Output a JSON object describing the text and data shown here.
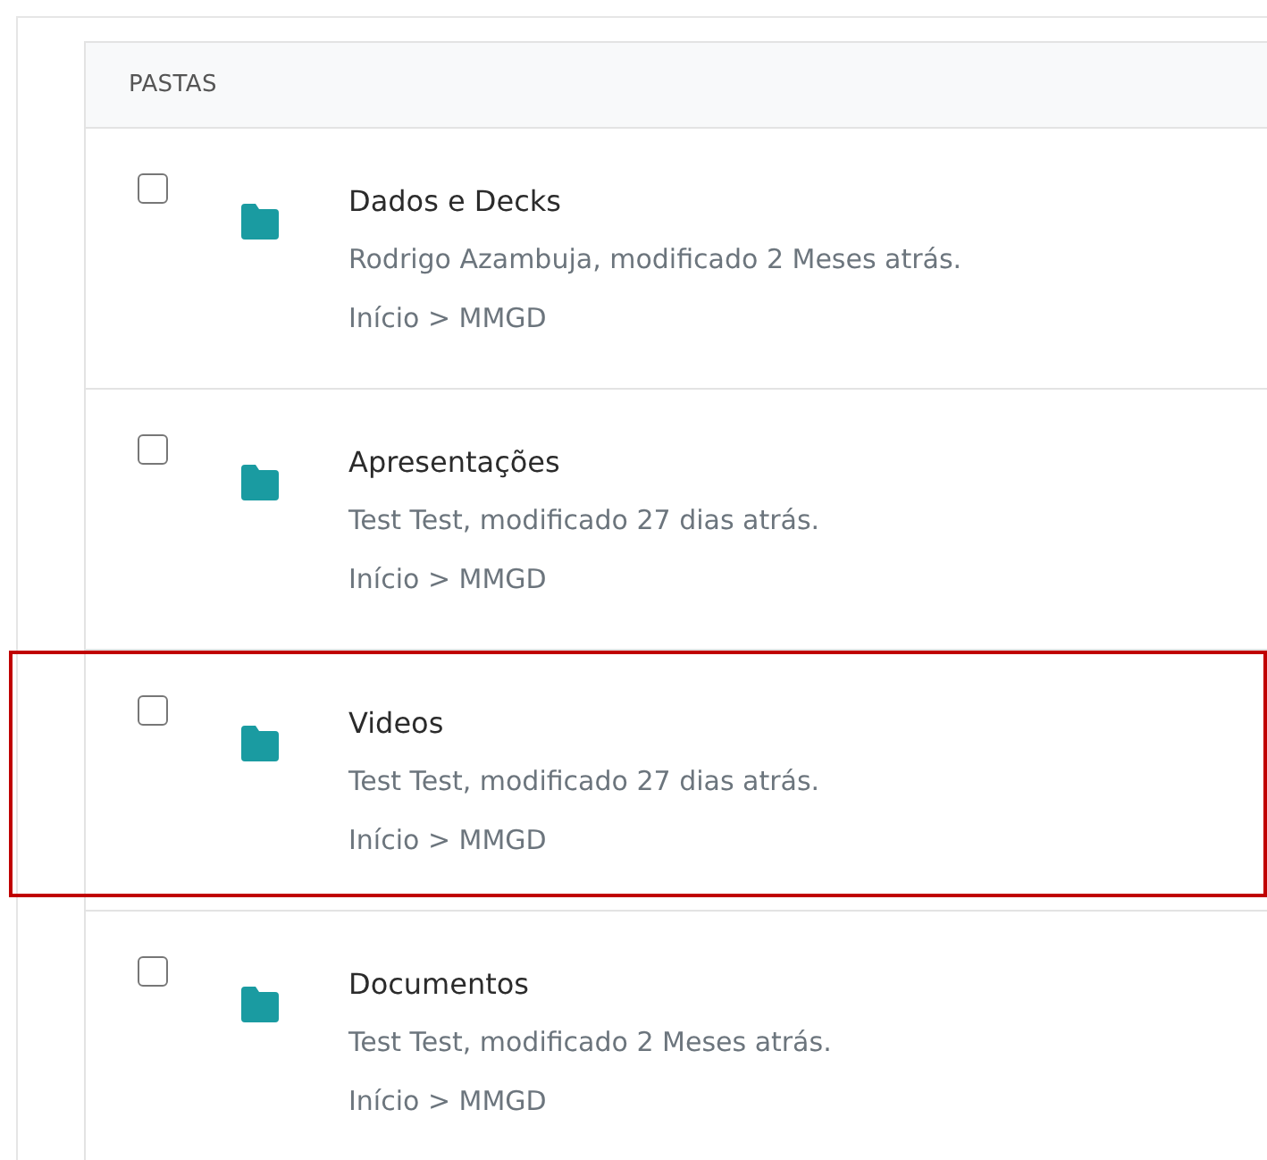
{
  "header": {
    "title": "PASTAS"
  },
  "folders": [
    {
      "name": "Dados e Decks",
      "meta": "Rodrigo Azambuja, modificado 2 Meses atrás.",
      "path": "Início > MMGD",
      "checked": false,
      "highlighted": false
    },
    {
      "name": "Apresentações",
      "meta": "Test Test, modificado 27 dias atrás.",
      "path": "Início > MMGD",
      "checked": false,
      "highlighted": false
    },
    {
      "name": "Videos",
      "meta": "Test Test, modificado 27 dias atrás.",
      "path": "Início > MMGD",
      "checked": false,
      "highlighted": true
    },
    {
      "name": "Documentos",
      "meta": "Test Test, modificado 2 Meses atrás.",
      "path": "Início > MMGD",
      "checked": false,
      "highlighted": false
    }
  ]
}
